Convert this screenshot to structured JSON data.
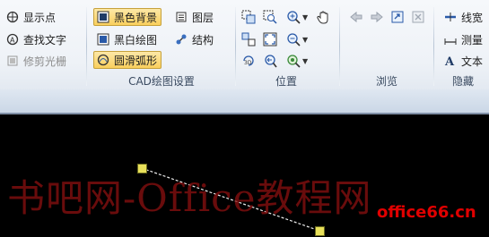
{
  "ribbon": {
    "group1": {
      "items": [
        {
          "label": "显示点",
          "icon": "crosshair-icon"
        },
        {
          "label": "查找文字",
          "icon": "find-text-icon"
        },
        {
          "label": "修剪光栅",
          "icon": "trim-raster-icon"
        }
      ]
    },
    "cad_settings": {
      "label": "CAD绘图设置",
      "items": [
        {
          "label": "黑色背景",
          "icon": "black-background-icon"
        },
        {
          "label": "图层",
          "icon": "layers-icon"
        },
        {
          "label": "黑白绘图",
          "icon": "black-white-icon"
        },
        {
          "label": "结构",
          "icon": "structure-icon"
        },
        {
          "label": "圆滑弧形",
          "icon": "smooth-arc-icon"
        }
      ]
    },
    "position": {
      "label": "位置"
    },
    "browse": {
      "label": "浏览"
    },
    "hide": {
      "label": "隐藏",
      "items": [
        {
          "label": "线宽",
          "icon": "line-width-icon"
        },
        {
          "label": "测量",
          "icon": "measure-icon"
        },
        {
          "label": "文本",
          "icon": "text-icon"
        }
      ]
    }
  },
  "watermark": {
    "text": "书吧网-Office教程网",
    "brand": "office66.cn"
  }
}
